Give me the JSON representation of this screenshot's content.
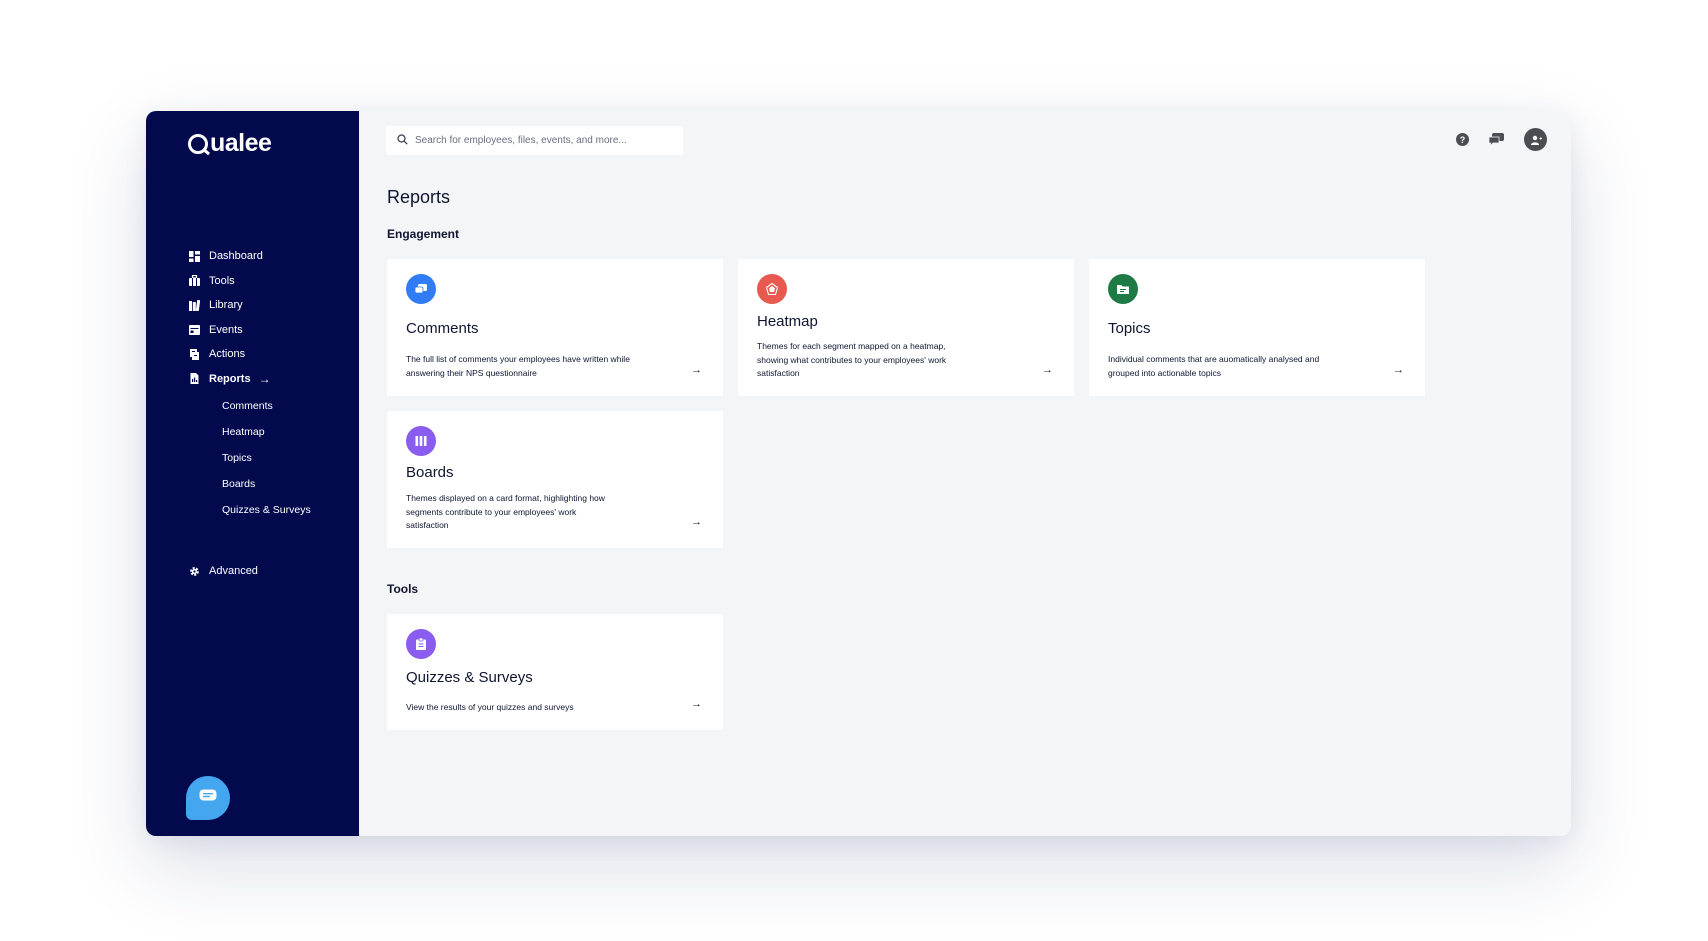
{
  "app": {
    "brand": "Qualee",
    "accent": "#020a4d",
    "background": "#f4f5f7"
  },
  "sidebar": {
    "items": [
      {
        "label": "Dashboard",
        "icon": "dashboard-icon"
      },
      {
        "label": "Tools",
        "icon": "toolbox-icon"
      },
      {
        "label": "Library",
        "icon": "library-icon"
      },
      {
        "label": "Events",
        "icon": "calendar-icon"
      },
      {
        "label": "Actions",
        "icon": "actions-icon"
      },
      {
        "label": "Reports",
        "icon": "report-icon",
        "active": true
      }
    ],
    "reports_arrow": "→",
    "subitems": [
      "Comments",
      "Heatmap",
      "Topics",
      "Boards",
      "Quizzes & Surveys"
    ],
    "advanced": {
      "label": "Advanced",
      "icon": "gear-icon"
    },
    "chat_icon": "chat-icon"
  },
  "header": {
    "search_placeholder": "Search for employees, files, events, and more...",
    "icons": [
      "help-icon",
      "messages-icon",
      "avatar"
    ]
  },
  "main": {
    "title": "Reports",
    "engagement": {
      "heading": "Engagement",
      "cards": [
        {
          "title": "Comments",
          "desc": "The full list of comments your employees have written while answering their NPS questionnaire",
          "icon_color": "#2f7cf6",
          "icon": "comments-icon"
        },
        {
          "title": "Heatmap",
          "desc": "Themes for each segment mapped on a heatmap, showing what contributes to your employees' work satisfaction",
          "icon_color": "#e8594f",
          "icon": "heatmap-icon"
        },
        {
          "title": "Topics",
          "desc": "Individual comments that are auomatically analysed and grouped into actionable topics",
          "icon_color": "#1f7a45",
          "icon": "folder-icon"
        },
        {
          "title": "Boards",
          "desc": "Themes displayed on a card format, highlighting how segments contribute to your employees' work satisfaction",
          "icon_color": "#8a5cf0",
          "icon": "boards-icon"
        }
      ]
    },
    "tools": {
      "heading": "Tools",
      "cards": [
        {
          "title": "Quizzes & Surveys",
          "desc": "View the results of your quizzes and surveys",
          "icon_color": "#8a5cf0",
          "icon": "clipboard-icon"
        }
      ]
    },
    "arrow": "→"
  }
}
